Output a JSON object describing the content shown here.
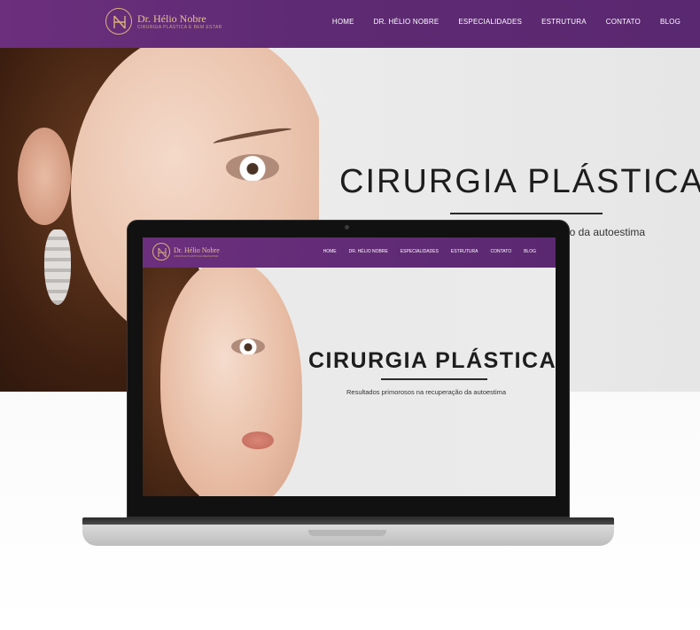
{
  "brand": {
    "name": "Dr. Hélio Nobre",
    "tagline": "CIRURGIA PLÁSTICA E BEM ESTAR",
    "primary_color": "#5e2a73",
    "accent_color": "#d9b27a"
  },
  "nav": {
    "items": [
      {
        "label": "HOME"
      },
      {
        "label": "DR. HÉLIO NOBRE"
      },
      {
        "label": "ESPECIALIDADES"
      },
      {
        "label": "ESTRUTURA"
      },
      {
        "label": "CONTATO"
      },
      {
        "label": "BLOG"
      }
    ]
  },
  "hero": {
    "title": "CIRURGIA PLÁSTICA",
    "subtitle_visible": "ão da autoestima"
  },
  "laptop": {
    "brand_name": "Dr. Hélio Nobre",
    "brand_tagline": "CIRURGIA PLÁSTICA E BEM ESTAR",
    "nav_items": [
      {
        "label": "HOME"
      },
      {
        "label": "DR. HÉLIO NOBRE"
      },
      {
        "label": "ESPECIALIDADES"
      },
      {
        "label": "ESTRUTURA"
      },
      {
        "label": "CONTATO"
      },
      {
        "label": "BLOG"
      }
    ],
    "hero_title": "CIRURGIA PLÁSTICA",
    "hero_subtitle": "Resultados primorosos na recuperação da autoestima"
  }
}
